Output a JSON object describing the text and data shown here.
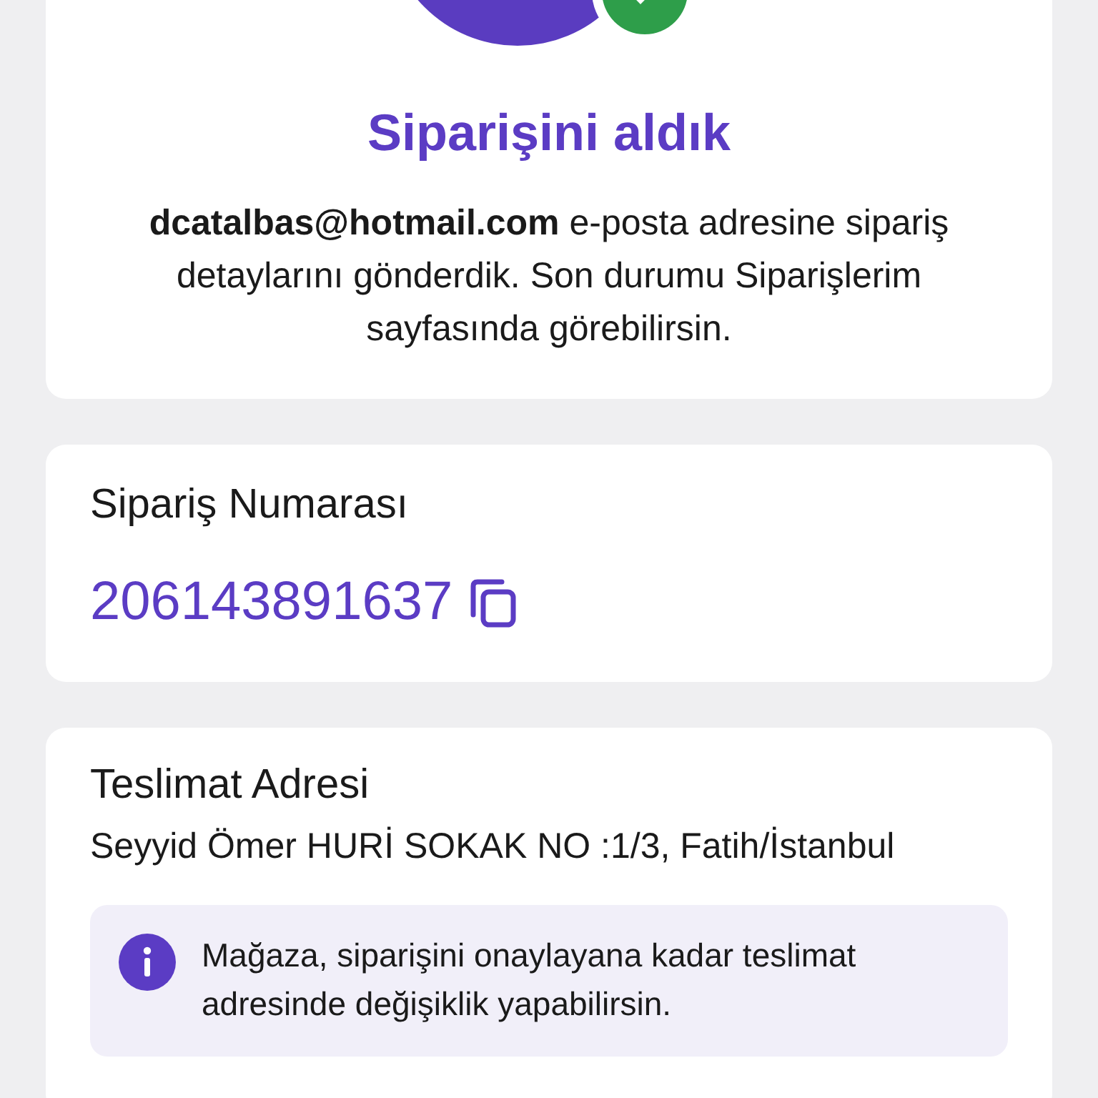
{
  "confirmation": {
    "title": "Siparişini aldık",
    "message": "**dcatalbas@hotmail.com** e-posta adresine sipariş detaylarını gönderdik. Son durumu Siparişlerim sayfasında görebilirsin."
  },
  "order": {
    "label": "Sipariş Numarası",
    "number": "206143891637"
  },
  "delivery": {
    "title": "Teslimat Adresi",
    "address": "Seyyid Ömer HURİ SOKAK NO :1/3, Fatih/İstanbul",
    "info": "Mağaza, siparişini onaylayana kadar teslimat adresinde değişiklik yapabilirsin."
  }
}
